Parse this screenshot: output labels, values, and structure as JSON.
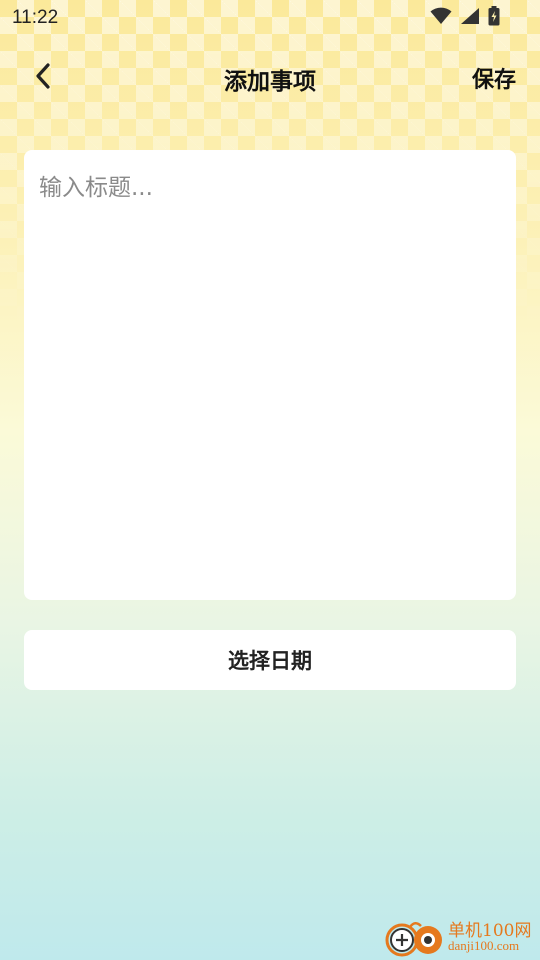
{
  "status_bar": {
    "time": "11:22",
    "icons": [
      "wifi-icon",
      "cell-signal-icon",
      "battery-charging-icon"
    ]
  },
  "app_bar": {
    "back_icon": "chevron-left-icon",
    "title": "添加事项",
    "save_label": "保存"
  },
  "editor": {
    "title_placeholder": "输入标题...",
    "title_value": ""
  },
  "date_button": {
    "label": "选择日期"
  },
  "watermark": {
    "name": "单机100网",
    "url": "danji100.com"
  },
  "colors": {
    "accent": "#e5791e",
    "card": "#ffffff",
    "background_top": "#fbe99a",
    "background_bottom": "#bfe9ec"
  }
}
